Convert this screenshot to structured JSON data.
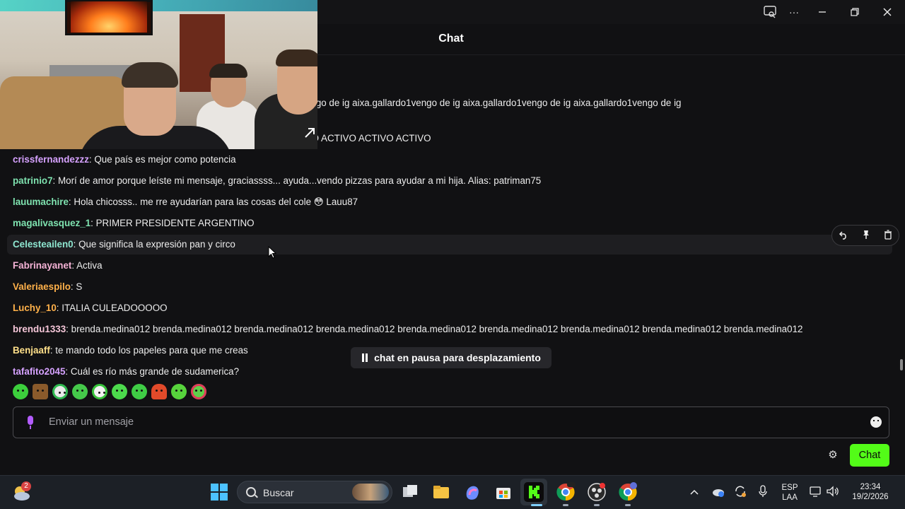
{
  "window": {
    "title": "Chat",
    "controls": [
      "cast-icon",
      "more-icon",
      "minimize-icon",
      "restore-icon",
      "close-icon"
    ]
  },
  "messages": [
    {
      "user": "",
      "text": "g aixa.gallardo1vengo de ig aixa.gallardo1vengo de ig aixa.gallardo1vengo de ig aixa.gallardo1vengo de ig aixa.gallardo1vengo de ig aixa.gallardo1vengo de ig",
      "color": "#ededed"
    },
    {
      "user": "",
      "text": "O ACTIVO ACTIVO ACTIVO ACTIVO ACTIVO ACTIVO ACTIVO ACTIVO ACTIVO ACTIVO ACTIVO",
      "color": "#ededed"
    },
    {
      "user": "crissfernandezzz",
      "text": "Que país es mejor como potencia",
      "color": "#d6a2ff"
    },
    {
      "user": "patrinio7",
      "text": "Morí de amor porque leíste mi mensaje, graciassss... ayuda...vendo pizzas para ayudar a mi hija. Alias: patriman75",
      "color": "#7fe3b0"
    },
    {
      "user": "lauumachire",
      "text": "Hola chicosss.. me rre ayudarían para las cosas del cole 😳 Lauu87",
      "color": "#7fe3b0"
    },
    {
      "user": "magalivasquez_1",
      "text": "PRIMER PRESIDENTE ARGENTINO",
      "color": "#7fe3b0"
    },
    {
      "user": "Celesteailen0",
      "text": "Que significa la expresión pan y circo",
      "color": "#8ee6d0"
    },
    {
      "user": "Fabrinayanet",
      "text": "Activa",
      "color": "#f5b3d6"
    },
    {
      "user": "Valeriaespilo",
      "text": "S",
      "color": "#ffb14a"
    },
    {
      "user": "Luchy_10",
      "text": "ITALIA CULEADOOOOO",
      "color": "#ffb14a"
    },
    {
      "user": "brendu1333",
      "text": "brenda.medina012 brenda.medina012 brenda.medina012 brenda.medina012 brenda.medina012 brenda.medina012 brenda.medina012 brenda.medina012 brenda.medina012",
      "color": "#f5c6d8"
    },
    {
      "user": "Benjaaff",
      "text": "te mando todo los papeles para que me creas",
      "color": "#ffe08a"
    },
    {
      "user": "tafafito2045",
      "text": "Cuál es río más grande de sudamerica?",
      "color": "#d6a2ff"
    }
  ],
  "message_tools": {
    "icons": [
      "reply-icon",
      "pin-icon",
      "delete-icon"
    ]
  },
  "pause_notice": "chat en pausa para desplazamiento",
  "input": {
    "placeholder": "Enviar un mensaje"
  },
  "send_button": "Chat",
  "emotes": [
    "green-blob-1",
    "brown-emote",
    "clown-emote",
    "green-blob-2",
    "green-clown",
    "green-blob-3",
    "green-blob-4",
    "mushroom-emote",
    "green-blob-5",
    "heart-eyes-emote"
  ],
  "taskbar": {
    "search_label": "Buscar",
    "weather_badge": "2",
    "language": "ESP",
    "layout": "LAA",
    "time": "23:34",
    "date": "19/2/2026"
  },
  "colors": {
    "accent": "#53fc18",
    "background": "#111113",
    "mic": "#b35cff"
  }
}
